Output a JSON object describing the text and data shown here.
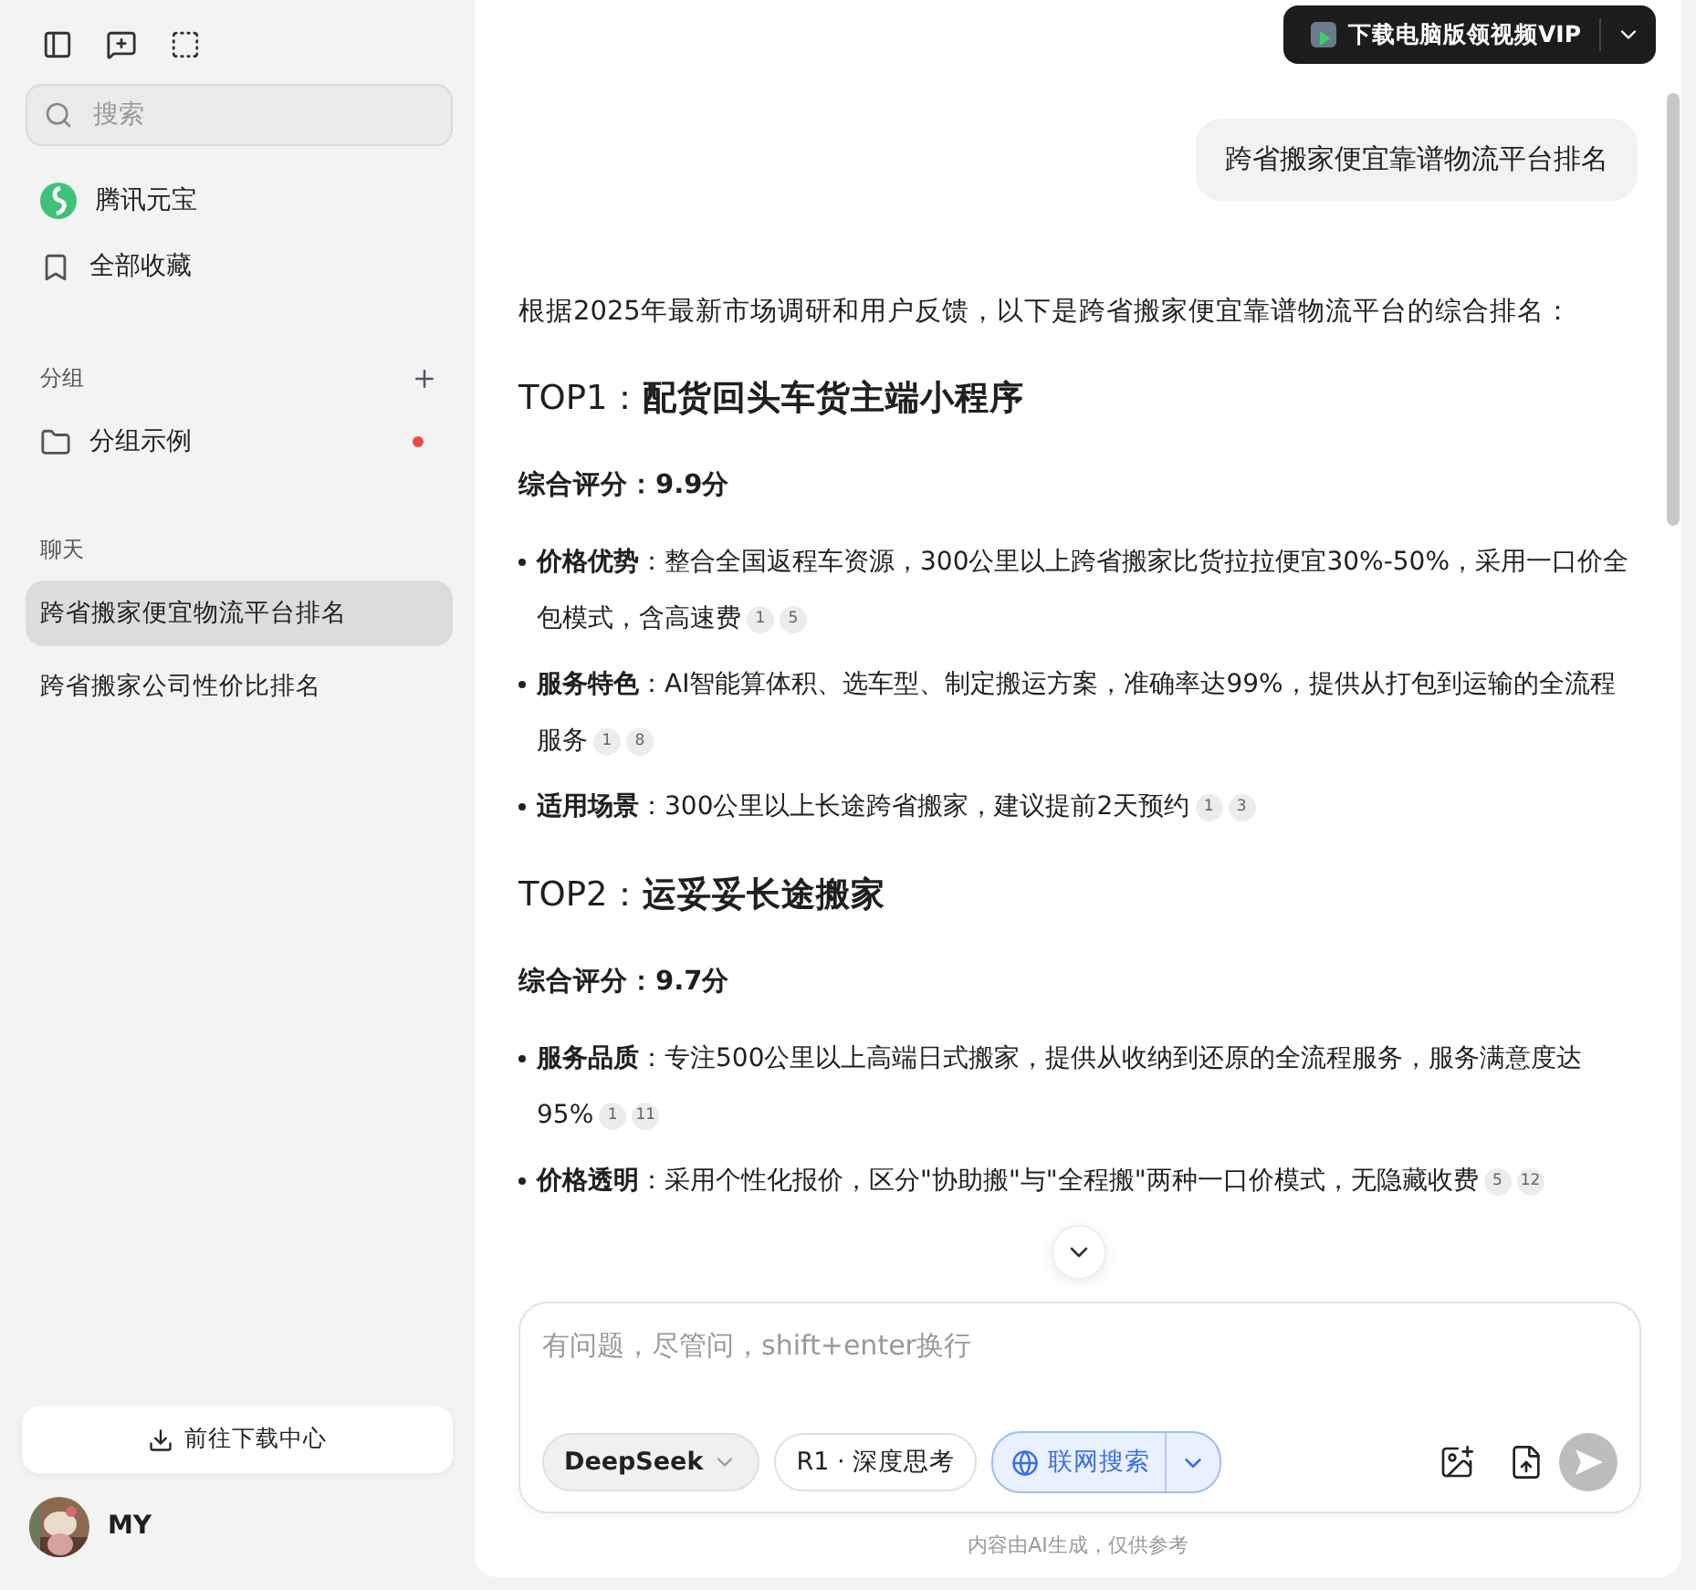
{
  "sidebar": {
    "search": {
      "placeholder": "搜索"
    },
    "nav": [
      {
        "kind": "logo",
        "label": "腾讯元宝"
      },
      {
        "kind": "bookmark",
        "label": "全部收藏"
      }
    ],
    "groups": {
      "title": "分组",
      "items": [
        {
          "label": "分组示例",
          "unread": true
        }
      ]
    },
    "chats": {
      "title": "聊天",
      "items": [
        {
          "label": "跨省搬家便宜物流平台排名",
          "selected": true
        },
        {
          "label": "跨省搬家公司性价比排名",
          "selected": false
        }
      ]
    },
    "download_button": "前往下载中心",
    "user": {
      "name": "MY"
    }
  },
  "header": {
    "vip_button": "下载电脑版领视频VIP"
  },
  "conversation": {
    "user_message": "跨省搬家便宜靠谱物流平台排名",
    "intro": "根据2025年最新市场调研和用户反馈，以下是跨省搬家便宜靠谱物流平台的综合排名：",
    "sections": [
      {
        "title": "TOP1：**配货回头车货主端小程序**",
        "score": "综合评分：9.9分",
        "bullets": [
          {
            "text": "**价格优势**：整合全国返程车资源，300公里以上跨省搬家比货拉拉便宜30%-50%，采用一口价全包模式，含高速费",
            "refs": [
              "1",
              "5"
            ]
          },
          {
            "text": "**服务特色**：AI智能算体积、选车型、制定搬运方案，准确率达99%，提供从打包到运输的全流程服务",
            "refs": [
              "1",
              "8"
            ]
          },
          {
            "text": "**适用场景**：300公里以上长途跨省搬家，建议提前2天预约",
            "refs": [
              "1",
              "3"
            ]
          }
        ]
      },
      {
        "title": "TOP2：**运妥妥长途搬家**",
        "score": "综合评分：9.7分",
        "bullets": [
          {
            "text": "**服务品质**：专注500公里以上高端日式搬家，提供从收纳到还原的全流程服务，服务满意度达95%",
            "refs": [
              "1",
              "11"
            ]
          },
          {
            "text": "**价格透明**：采用个性化报价，区分\"协助搬\"与\"全程搬\"两种一口价模式，无隐藏收费",
            "refs": [
              "5",
              "12"
            ]
          }
        ]
      }
    ]
  },
  "composer": {
    "placeholder": "有问题，尽管问，shift+enter换行",
    "model": "DeepSeek",
    "deep_think": {
      "label": "R1 · 深度思考",
      "selected": false
    },
    "web_search": {
      "label": "联网搜索",
      "selected": true
    }
  },
  "footer_note": "内容由AI生成，仅供参考"
}
